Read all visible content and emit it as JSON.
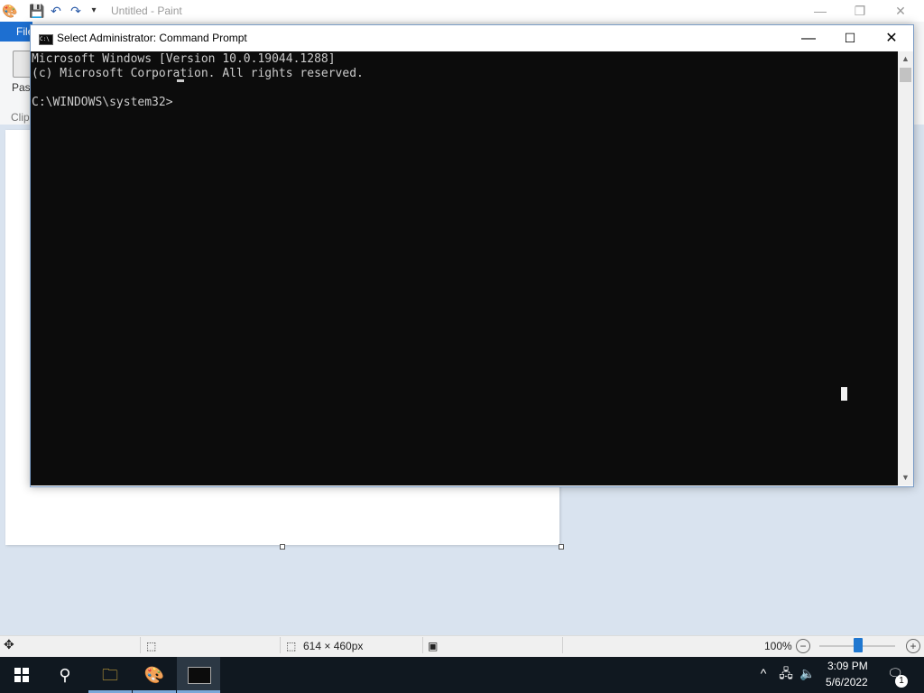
{
  "paint": {
    "title": "Untitled - Paint",
    "file_tab": "File",
    "paste_label": "Paste",
    "clipboard_group": "Clipboard",
    "status": {
      "dimensions": "614 × 460px",
      "zoom": "100%"
    }
  },
  "cmd": {
    "title": "Select Administrator: Command Prompt",
    "icon_text": "C:\\",
    "lines": [
      "Microsoft Windows [Version 10.0.19044.1288]",
      "(c) Microsoft Corporation. All rights reserved.",
      "",
      "C:\\WINDOWS\\system32>"
    ]
  },
  "taskbar": {
    "time": "3:09 PM",
    "date": "5/6/2022",
    "notification_count": "1",
    "apps": [
      "start",
      "search",
      "file-explorer",
      "paint",
      "command-prompt"
    ]
  },
  "colors": {
    "console_bg": "#0c0c0c",
    "console_text": "#cccccc",
    "file_tab": "#1d6fd1",
    "taskbar": "#101820"
  }
}
